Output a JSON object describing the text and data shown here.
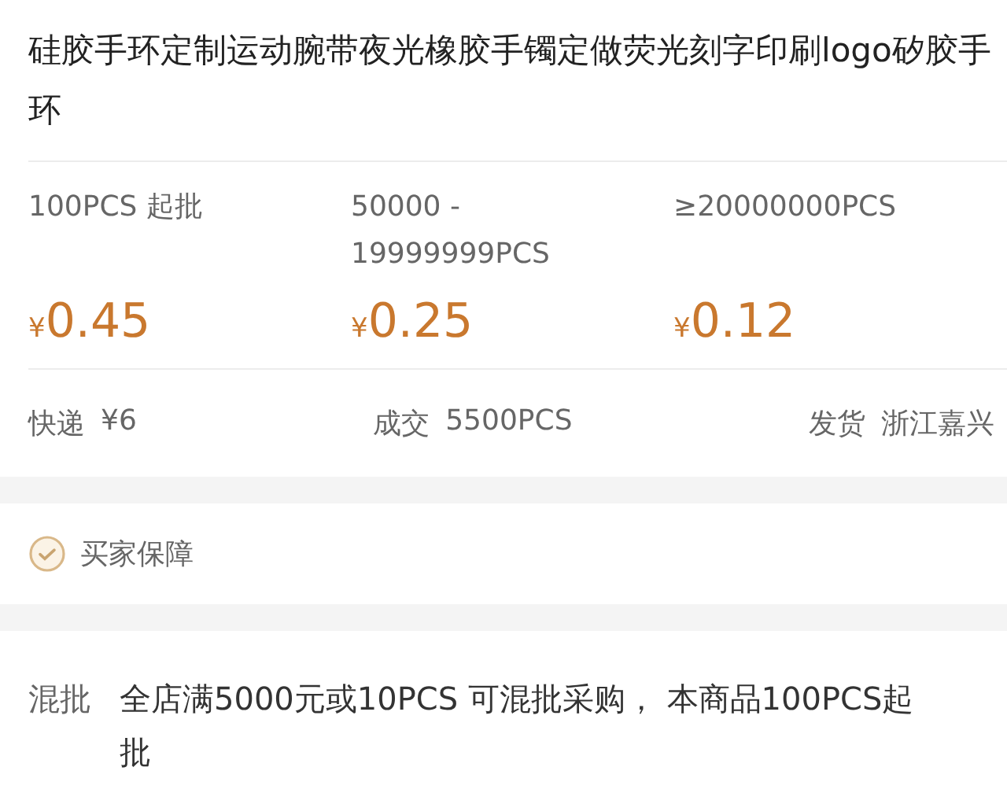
{
  "product": {
    "title": "硅胶手环定制运动腕带夜光橡胶手镯定做荧光刻字印刷logo矽胶手环"
  },
  "price_tiers": [
    {
      "quantity": "100PCS 起批",
      "currency": "¥",
      "price": "0.45"
    },
    {
      "quantity": "50000 - 19999999PCS",
      "currency": "¥",
      "price": "0.25"
    },
    {
      "quantity": "≥20000000PCS",
      "currency": "¥",
      "price": "0.12"
    }
  ],
  "info": [
    {
      "label": "快递",
      "value": "¥6"
    },
    {
      "label": "成交",
      "value": "5500PCS"
    },
    {
      "label": "发货",
      "value": "浙江嘉兴"
    }
  ],
  "guarantee": {
    "label": "买家保障"
  },
  "mixed_batch": {
    "label": "混批",
    "text": "全店满5000元或10PCS 可混批采购， 本商品100PCS起批"
  }
}
